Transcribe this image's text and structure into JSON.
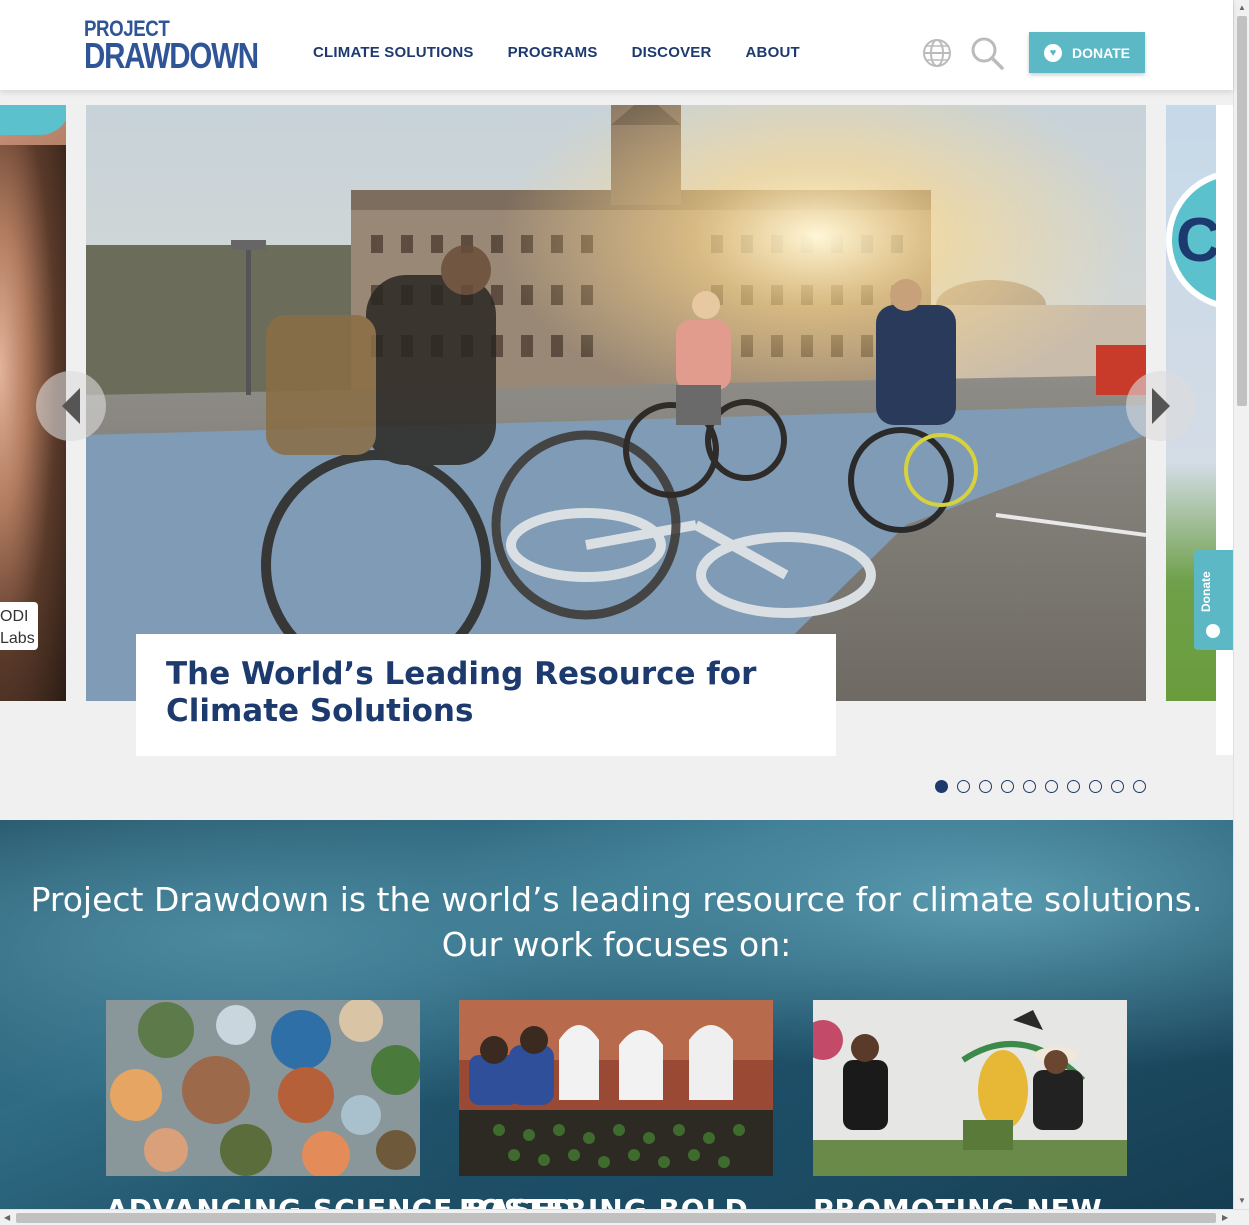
{
  "header": {
    "logo_line1": "PROJECT",
    "logo_line2": "DRAWDOWN",
    "nav": [
      "CLIMATE SOLUTIONS",
      "PROGRAMS",
      "DISCOVER",
      "ABOUT"
    ],
    "donate_label": "DONATE"
  },
  "carousel": {
    "caption": "The World’s Leading Resource for Climate Solutions",
    "left_badge_line1": "ODI",
    "left_badge_line2": "Labs",
    "right_slide_text": "CH",
    "slide_count": 10,
    "active_slide": 1
  },
  "side_tab": {
    "label": "Donate"
  },
  "focus": {
    "heading_line1": "Project Drawdown is the world’s leading resource for climate solutions.",
    "heading_line2": "Our work focuses on:",
    "cards": [
      {
        "title": "ADVANCING SCIENCE-BASED"
      },
      {
        "title": "FOSTERING BOLD"
      },
      {
        "title": "PROMOTING NEW"
      }
    ]
  },
  "colors": {
    "brand_blue": "#1d3a6e",
    "teal": "#5bb8c4"
  }
}
